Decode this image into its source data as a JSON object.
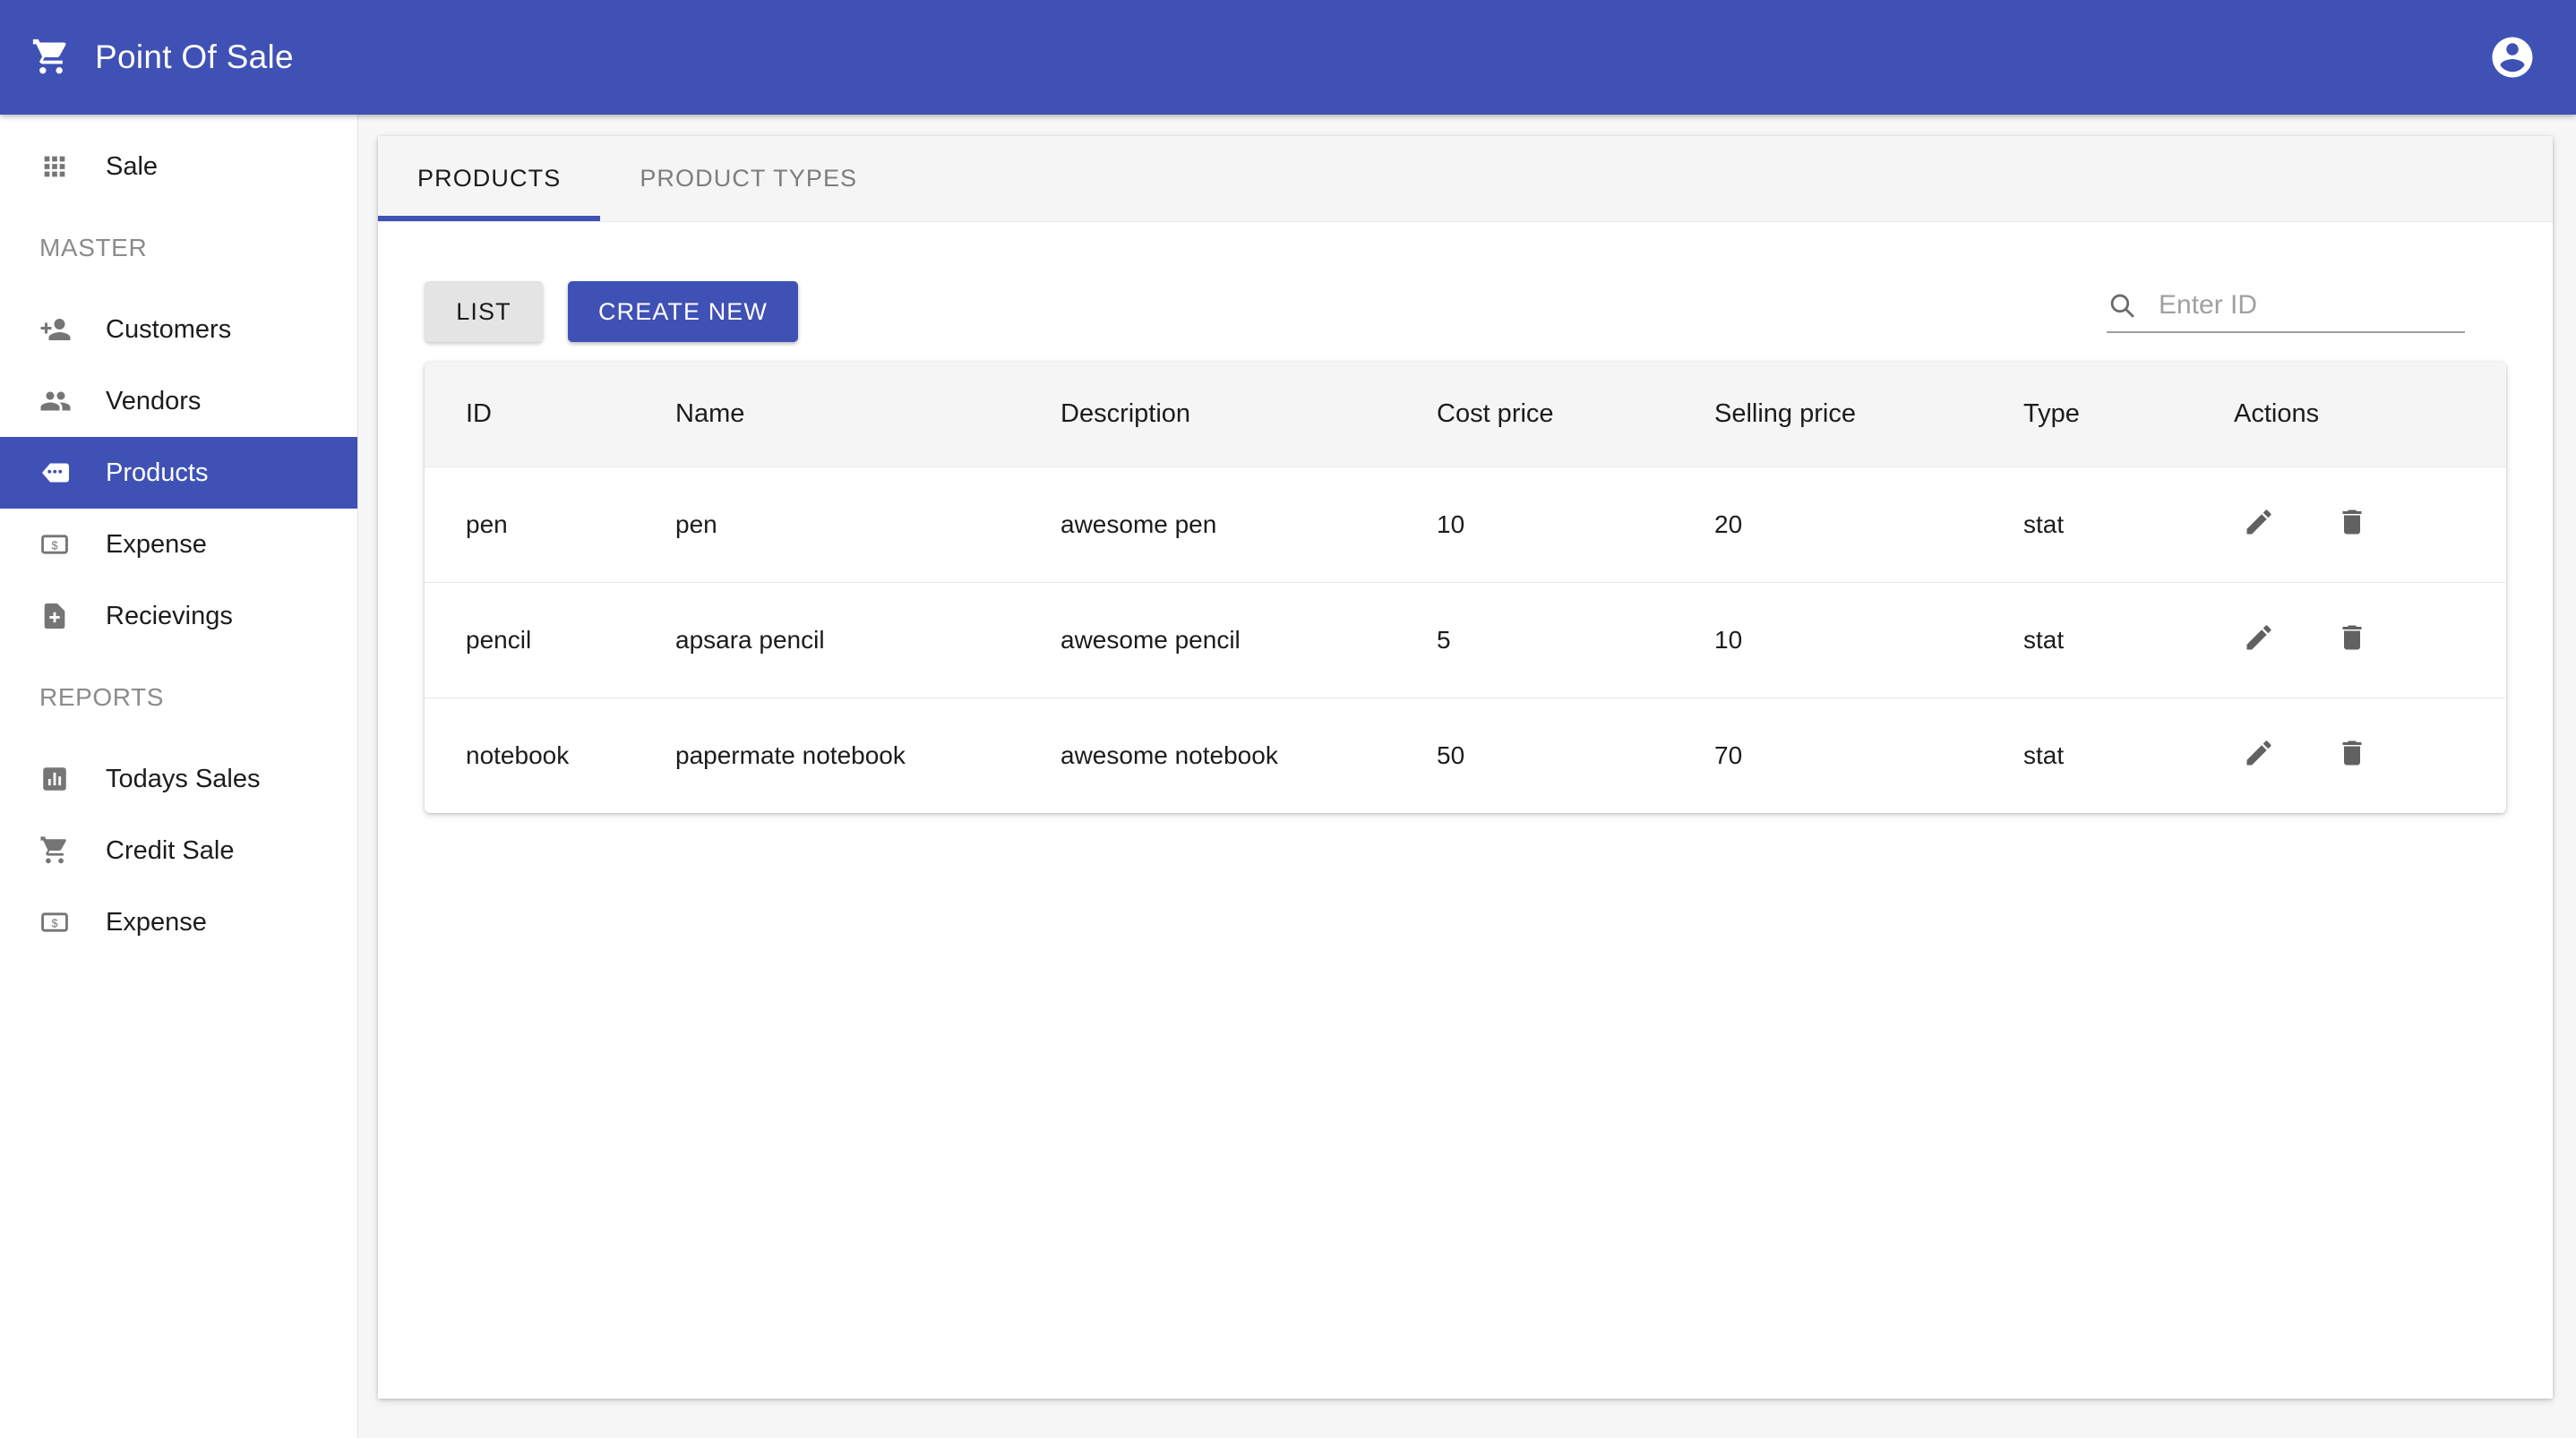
{
  "app": {
    "title": "Point Of Sale",
    "accent_color": "#3f51b5",
    "brand_icon": "shopping-cart-icon",
    "account_icon": "account-circle-icon"
  },
  "sidebar": {
    "items": [
      {
        "label": "Sale",
        "icon": "apps-grid-icon",
        "active": false,
        "type": "item"
      },
      {
        "label": "MASTER",
        "type": "section"
      },
      {
        "label": "Customers",
        "icon": "person-add-icon",
        "active": false,
        "type": "item"
      },
      {
        "label": "Vendors",
        "icon": "people-icon",
        "active": false,
        "type": "item"
      },
      {
        "label": "Products",
        "icon": "loyalty-tag-icon",
        "active": true,
        "type": "item"
      },
      {
        "label": "Expense",
        "icon": "money-note-icon",
        "active": false,
        "type": "item"
      },
      {
        "label": "Recievings",
        "icon": "note-add-icon",
        "active": false,
        "type": "item"
      },
      {
        "label": "REPORTS",
        "type": "section"
      },
      {
        "label": "Todays Sales",
        "icon": "bar-chart-icon",
        "active": false,
        "type": "item"
      },
      {
        "label": "Credit Sale",
        "icon": "shopping-cart-icon",
        "active": false,
        "type": "item"
      },
      {
        "label": "Expense",
        "icon": "money-note-icon",
        "active": false,
        "type": "item"
      }
    ]
  },
  "main": {
    "tabs": [
      {
        "label": "PRODUCTS",
        "active": true
      },
      {
        "label": "PRODUCT TYPES",
        "active": false
      }
    ],
    "toolbar": {
      "list_label": "LIST",
      "create_label": "CREATE NEW"
    },
    "search": {
      "placeholder": "Enter ID",
      "value": "",
      "icon": "search-icon"
    },
    "table": {
      "columns": [
        "ID",
        "Name",
        "Description",
        "Cost price",
        "Selling price",
        "Type",
        "Actions"
      ],
      "rows": [
        {
          "id": "pen",
          "name": "pen",
          "description": "awesome pen",
          "cost_price": "10",
          "selling_price": "20",
          "type": "stat"
        },
        {
          "id": "pencil",
          "name": "apsara pencil",
          "description": "awesome pencil",
          "cost_price": "5",
          "selling_price": "10",
          "type": "stat"
        },
        {
          "id": "notebook",
          "name": "papermate notebook",
          "description": "awesome notebook",
          "cost_price": "50",
          "selling_price": "70",
          "type": "stat"
        }
      ],
      "row_actions": [
        {
          "name": "edit-row-button",
          "icon": "pencil-edit-icon"
        },
        {
          "name": "delete-row-button",
          "icon": "trash-delete-icon"
        }
      ]
    }
  }
}
